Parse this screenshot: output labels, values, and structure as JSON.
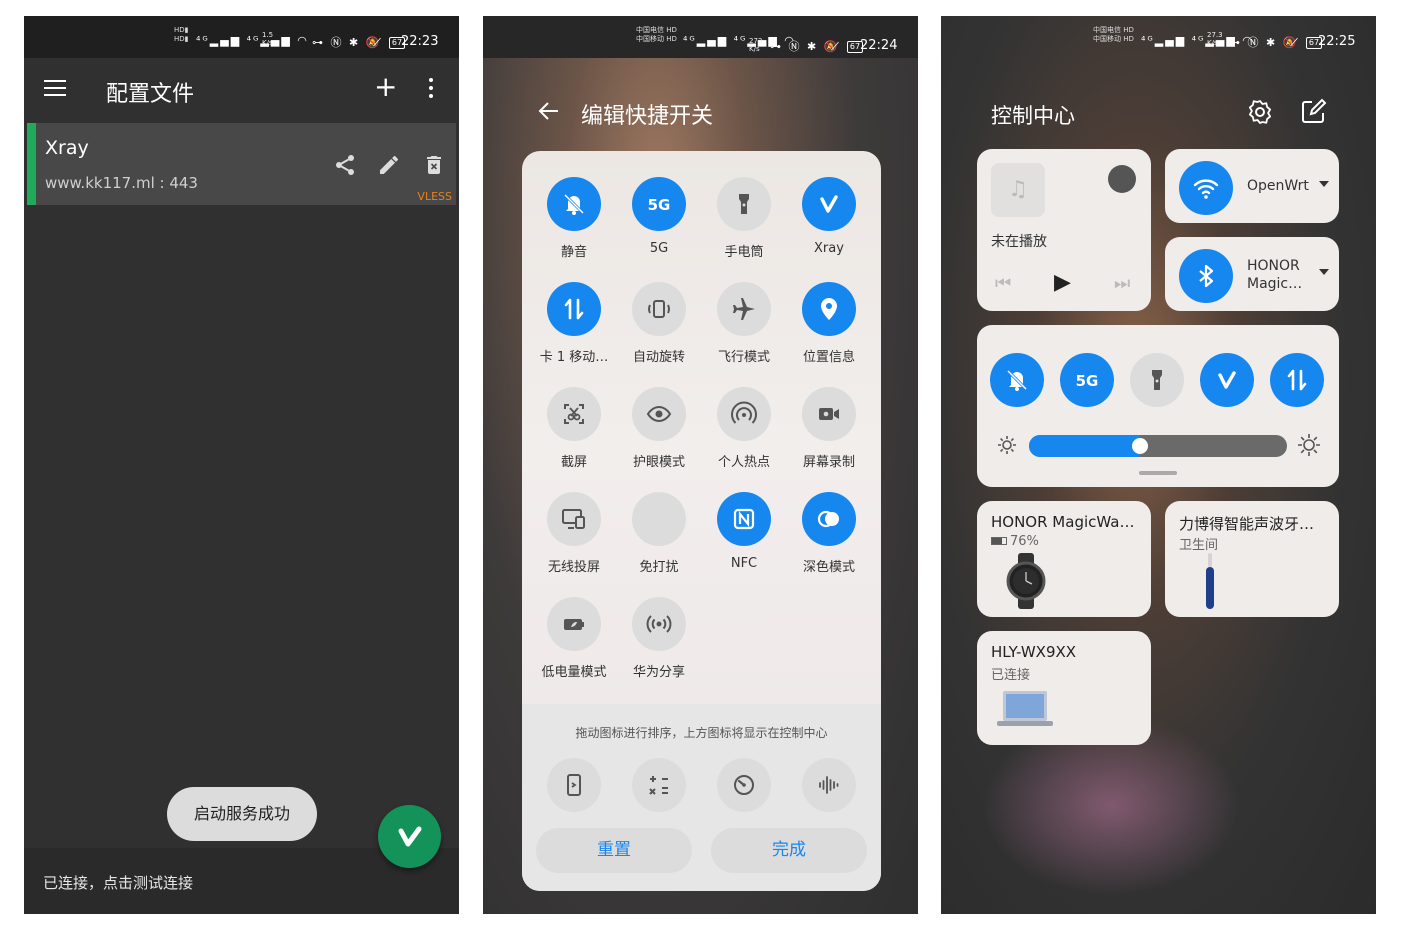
{
  "phone1": {
    "status": {
      "speed": "1.5\nK/s",
      "time": "22:23",
      "battery": "67"
    },
    "toolbar": {
      "title": "配置文件",
      "add": "+"
    },
    "profile": {
      "name": "Xray",
      "address": "www.kk117.ml : 443",
      "protocol": "VLESS"
    },
    "toast": "启动服务成功",
    "connection_status": "已连接，点击测试连接"
  },
  "phone2": {
    "status": {
      "carrier1": "中国电信",
      "carrier2": "中国移动",
      "speed": "273",
      "speed_unit": "K/s",
      "time": "22:24",
      "battery": "67"
    },
    "title": "编辑快捷开关",
    "tiles": [
      {
        "label": "静音",
        "on": true,
        "icon": "bell-off-icon"
      },
      {
        "label": "5G",
        "on": true,
        "icon": "5g-icon"
      },
      {
        "label": "手电筒",
        "on": false,
        "icon": "flashlight-icon"
      },
      {
        "label": "Xray",
        "on": true,
        "icon": "v-icon"
      },
      {
        "label": "卡 1 移动…",
        "on": true,
        "icon": "data-arrows-icon"
      },
      {
        "label": "自动旋转",
        "on": false,
        "icon": "rotate-icon"
      },
      {
        "label": "飞行模式",
        "on": false,
        "icon": "airplane-icon"
      },
      {
        "label": "位置信息",
        "on": true,
        "icon": "location-icon"
      },
      {
        "label": "截屏",
        "on": false,
        "icon": "screenshot-icon"
      },
      {
        "label": "护眼模式",
        "on": false,
        "icon": "eye-icon"
      },
      {
        "label": "个人热点",
        "on": false,
        "icon": "hotspot-icon"
      },
      {
        "label": "屏幕录制",
        "on": false,
        "icon": "record-icon"
      },
      {
        "label": "无线投屏",
        "on": false,
        "icon": "cast-icon"
      },
      {
        "label": "免打扰",
        "on": false,
        "icon": "moon-icon"
      },
      {
        "label": "NFC",
        "on": true,
        "icon": "nfc-icon"
      },
      {
        "label": "深色模式",
        "on": true,
        "icon": "dark-mode-icon"
      },
      {
        "label": "低电量模式",
        "on": false,
        "icon": "battery-saver-icon"
      },
      {
        "label": "华为分享",
        "on": false,
        "icon": "share-wave-icon"
      }
    ],
    "hint": "拖动图标进行排序，上方图标将显示在控制中心",
    "extra_icons": [
      "phone-icon",
      "calculator-icon",
      "timer-icon",
      "sound-wave-icon"
    ],
    "reset": "重置",
    "done": "完成"
  },
  "phone3": {
    "status": {
      "carrier1": "中国电信",
      "carrier2": "中国移动",
      "speed": "27.3",
      "speed_unit": "K/s",
      "time": "22:25",
      "battery": "67"
    },
    "title": "控制中心",
    "media": {
      "state": "未在播放"
    },
    "wifi": {
      "name": "OpenWrt"
    },
    "bluetooth": {
      "line1": "HONOR",
      "line2": "Magic…"
    },
    "brightness": 0.43,
    "devices": [
      {
        "name": "HONOR MagicWa…",
        "sub": "76%"
      },
      {
        "name": "力博得智能声波牙…",
        "sub": "卫生间"
      },
      {
        "name": "HLY-WX9XX",
        "sub": "已连接"
      }
    ],
    "accent": "#1787f0"
  }
}
